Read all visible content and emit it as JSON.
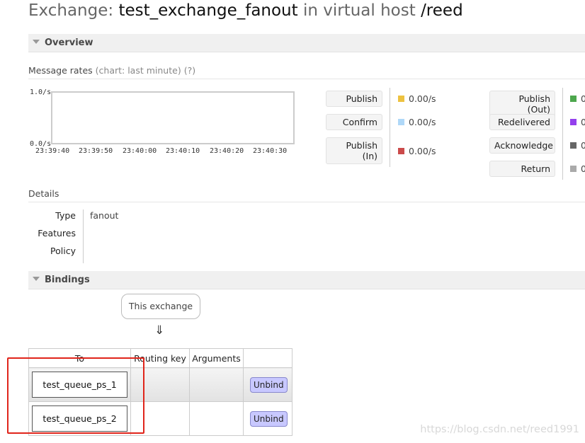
{
  "page_title": {
    "prefix": "Exchange: ",
    "exchange_name": "test_exchange_fanout",
    "middle": " in virtual host ",
    "vhost": "/reed"
  },
  "overview": {
    "header": "Overview",
    "message_rates_label": "Message rates",
    "chart_hint": "(chart: last minute)",
    "help_hint": "(?)",
    "chart": {
      "y_max_label": "1.0/s",
      "y_min_label": "0.0/s",
      "x_labels": [
        "23:39:40",
        "23:39:50",
        "23:40:00",
        "23:40:10",
        "23:40:20",
        "23:40:30"
      ]
    },
    "legend_left": [
      {
        "label": "Publish",
        "value": "0.00/s",
        "color": "#edc240"
      },
      {
        "label": "Confirm",
        "value": "0.00/s",
        "color": "#afd8f8"
      },
      {
        "label": "Publish\n(In)",
        "value": "0.00/s",
        "color": "#cb4b4b"
      }
    ],
    "legend_right": [
      {
        "label": "Publish (Out)",
        "value": "0",
        "color": "#4da74d"
      },
      {
        "label": "Redelivered",
        "value": "0",
        "color": "#9440ed"
      },
      {
        "label": "Acknowledge",
        "value": "0",
        "color": "#666666"
      },
      {
        "label": "Return",
        "value": "0",
        "color": "#aaaaaa"
      }
    ]
  },
  "details": {
    "header": "Details",
    "type_label": "Type",
    "type_value": "fanout",
    "features_label": "Features",
    "features_value": "",
    "policy_label": "Policy",
    "policy_value": ""
  },
  "bindings": {
    "header": "Bindings",
    "this_exchange": "This exchange",
    "arrow": "⇓",
    "columns": [
      "To",
      "Routing key",
      "Arguments",
      ""
    ],
    "rows": [
      {
        "to": "test_queue_ps_1",
        "routing_key": "",
        "arguments": "",
        "action": "Unbind"
      },
      {
        "to": "test_queue_ps_2",
        "routing_key": "",
        "arguments": "",
        "action": "Unbind"
      }
    ]
  },
  "watermark": "https://blog.csdn.net/reed1991"
}
